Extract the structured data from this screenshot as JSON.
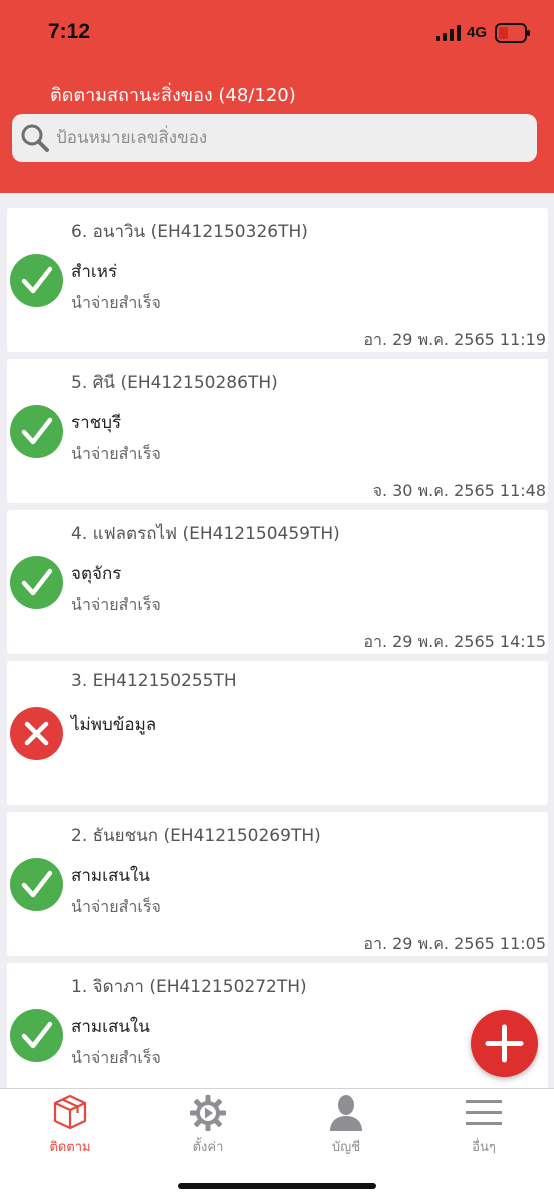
{
  "status_bar": {
    "time": "7:12",
    "network": "4G"
  },
  "header": {
    "title": "ติดตามสถานะสิ่งของ (48/120)"
  },
  "search": {
    "placeholder": "ป้อนหมายเลขสิ่งของ"
  },
  "colors": {
    "brand": "#e8473d",
    "success": "#4cae4c",
    "error": "#e23d3a"
  },
  "items": [
    {
      "title": "6. อนาวิน (EH412150326TH)",
      "location": "สำเหร่",
      "status": "นำจ่ายสำเร็จ",
      "date": "อา. 29 พ.ค. 2565 11:19",
      "state": "success"
    },
    {
      "title": "5. ศินี (EH412150286TH)",
      "location": "ราชบุรี",
      "status": "นำจ่ายสำเร็จ",
      "date": "จ. 30 พ.ค. 2565 11:48",
      "state": "success"
    },
    {
      "title": "4. แฟลตรถไฟ (EH412150459TH)",
      "location": "จตุจักร",
      "status": "นำจ่ายสำเร็จ",
      "date": "อา. 29 พ.ค. 2565 14:15",
      "state": "success"
    },
    {
      "title": "3. EH412150255TH",
      "location": "ไม่พบข้อมูล",
      "status": "",
      "date": "",
      "state": "error"
    },
    {
      "title": "2. ธันยชนก (EH412150269TH)",
      "location": "สามเสนใน",
      "status": "นำจ่ายสำเร็จ",
      "date": "อา. 29 พ.ค. 2565 11:05",
      "state": "success"
    },
    {
      "title": "1. จิดาภา (EH412150272TH)",
      "location": "สามเสนใน",
      "status": "นำจ่ายสำเร็จ",
      "date": "",
      "state": "success"
    }
  ],
  "tabs": [
    {
      "label": "ติดตาม",
      "icon": "package-icon",
      "active": true
    },
    {
      "label": "ตั้งค่า",
      "icon": "gear-icon",
      "active": false
    },
    {
      "label": "บัญชี",
      "icon": "user-icon",
      "active": false
    },
    {
      "label": "อื่นๆ",
      "icon": "menu-icon",
      "active": false
    }
  ],
  "fab": {
    "icon": "plus-icon"
  }
}
